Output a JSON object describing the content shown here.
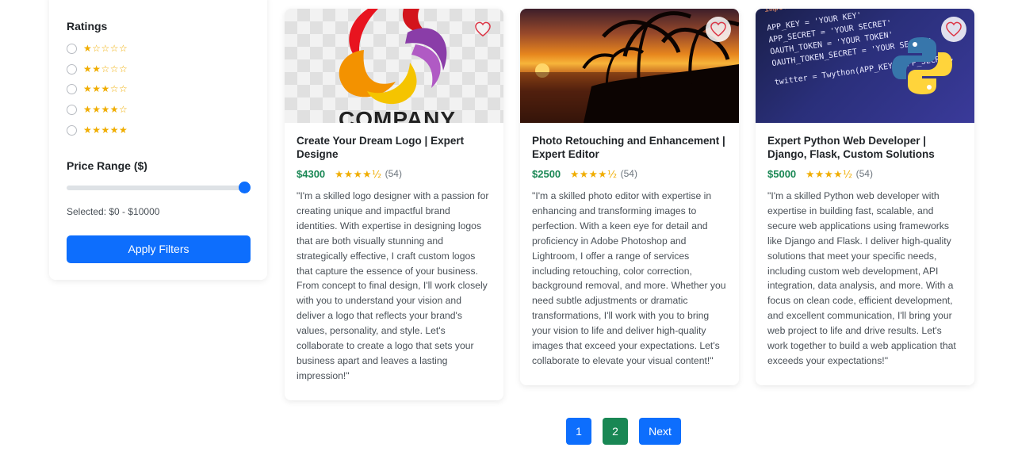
{
  "filters": {
    "ratings_title": "Ratings",
    "rating_options": [
      "★☆☆☆☆",
      "★★☆☆☆",
      "★★★☆☆",
      "★★★★☆",
      "★★★★★"
    ],
    "price_title": "Price Range ($)",
    "price_slider_value": 10000,
    "price_slider_max": 10000,
    "selected_text": "Selected: $0 - $10000",
    "apply_label": "Apply Filters"
  },
  "cards": [
    {
      "title": "Create Your Dream Logo | Expert Designe",
      "price": "$4300",
      "stars": "★★★★½",
      "reviews": "(54)",
      "image_text": "COMPANY",
      "description": "\"I'm a skilled logo designer with a passion for creating unique and impactful brand identities. With expertise in designing logos that are both visually stunning and strategically effective, I craft custom logos that capture the essence of your business. From concept to final design, I'll work closely with you to understand your vision and deliver a logo that reflects your brand's values, personality, and style. Let's collaborate to create a logo that sets your business apart and leaves a lasting impression!\""
    },
    {
      "title": "Photo Retouching and Enhancement | Expert Editor",
      "price": "$2500",
      "stars": "★★★★½",
      "reviews": "(54)",
      "description": "\"I'm a skilled photo editor with expertise in enhancing and transforming images to perfection. With a keen eye for detail and proficiency in Adobe Photoshop and Lightroom, I offer a range of services including retouching, color correction, background removal, and more. Whether you need subtle adjustments or dramatic transformations, I'll work with you to bring your vision to life and deliver high-quality images that exceed your expectations. Let's collaborate to elevate your visual content!\""
    },
    {
      "title": "Expert Python Web Developer | Django, Flask, Custom Solutions",
      "price": "$5000",
      "stars": "★★★★½",
      "reviews": "(54)",
      "code_lines": [
        "import time",
        "APP_KEY = 'YOUR KEY'",
        "APP_SECRET = 'YOUR SECRET'",
        "OAUTH_TOKEN = 'YOUR TOKEN'",
        "OAUTH_TOKEN_SECRET = 'YOUR SECRET'",
        "twitter = Twython(APP_KEY, APP_SECRET,"
      ],
      "description": "\"I'm a skilled Python web developer with expertise in building fast, scalable, and secure web applications using frameworks like Django and Flask. I deliver high-quality solutions that meet your specific needs, including custom web development, API integration, data analysis, and more. With a focus on clean code, efficient development, and excellent communication, I'll bring your web project to life and drive results. Let's work together to build a web application that exceeds your expectations!\""
    }
  ],
  "pagination": {
    "pages": [
      "1",
      "2"
    ],
    "next_label": "Next"
  },
  "colors": {
    "primary": "#0d6efd",
    "success": "#198754",
    "star": "#f0ad00",
    "heart": "#dc3545"
  }
}
